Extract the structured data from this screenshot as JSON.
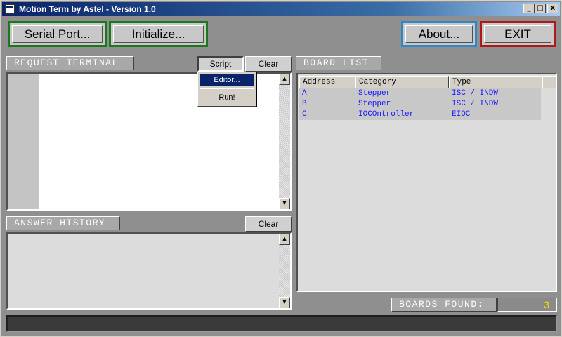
{
  "window": {
    "title": "Motion Term by Astel - Version 1.0",
    "controls": {
      "minimize": "_",
      "maximize": "□",
      "close": "x"
    }
  },
  "toolbar": {
    "serial_port": "Serial Port...",
    "initialize": "Initialize...",
    "about": "About...",
    "exit": "EXIT"
  },
  "request_terminal": {
    "label": "REQUEST TERMINAL",
    "script_button": "Script",
    "clear_button": "Clear",
    "script_menu": {
      "items": [
        "Editor...",
        "Run!"
      ],
      "selected": "Editor..."
    }
  },
  "answer_history": {
    "label": "ANSWER HISTORY",
    "clear_button": "Clear"
  },
  "board_list": {
    "label": "BOARD LIST",
    "columns": [
      "Address",
      "Category",
      "Type"
    ],
    "rows": [
      [
        "A",
        "Stepper",
        "ISC / INDW"
      ],
      [
        "B",
        "Stepper",
        "ISC / INDW"
      ],
      [
        "C",
        "IOCOntroller",
        "EIOC"
      ]
    ],
    "found_label": "BOARDS FOUND:",
    "found_count": "3"
  },
  "scroll": {
    "up": "▲",
    "down": "▼"
  },
  "colors": {
    "titlebar": "#0a246a",
    "green_border": "#1a7a1a",
    "blue_border": "#2f86c8",
    "red_border": "#b01818",
    "row_text": "#1a1aff",
    "count_text": "#f0e000"
  }
}
